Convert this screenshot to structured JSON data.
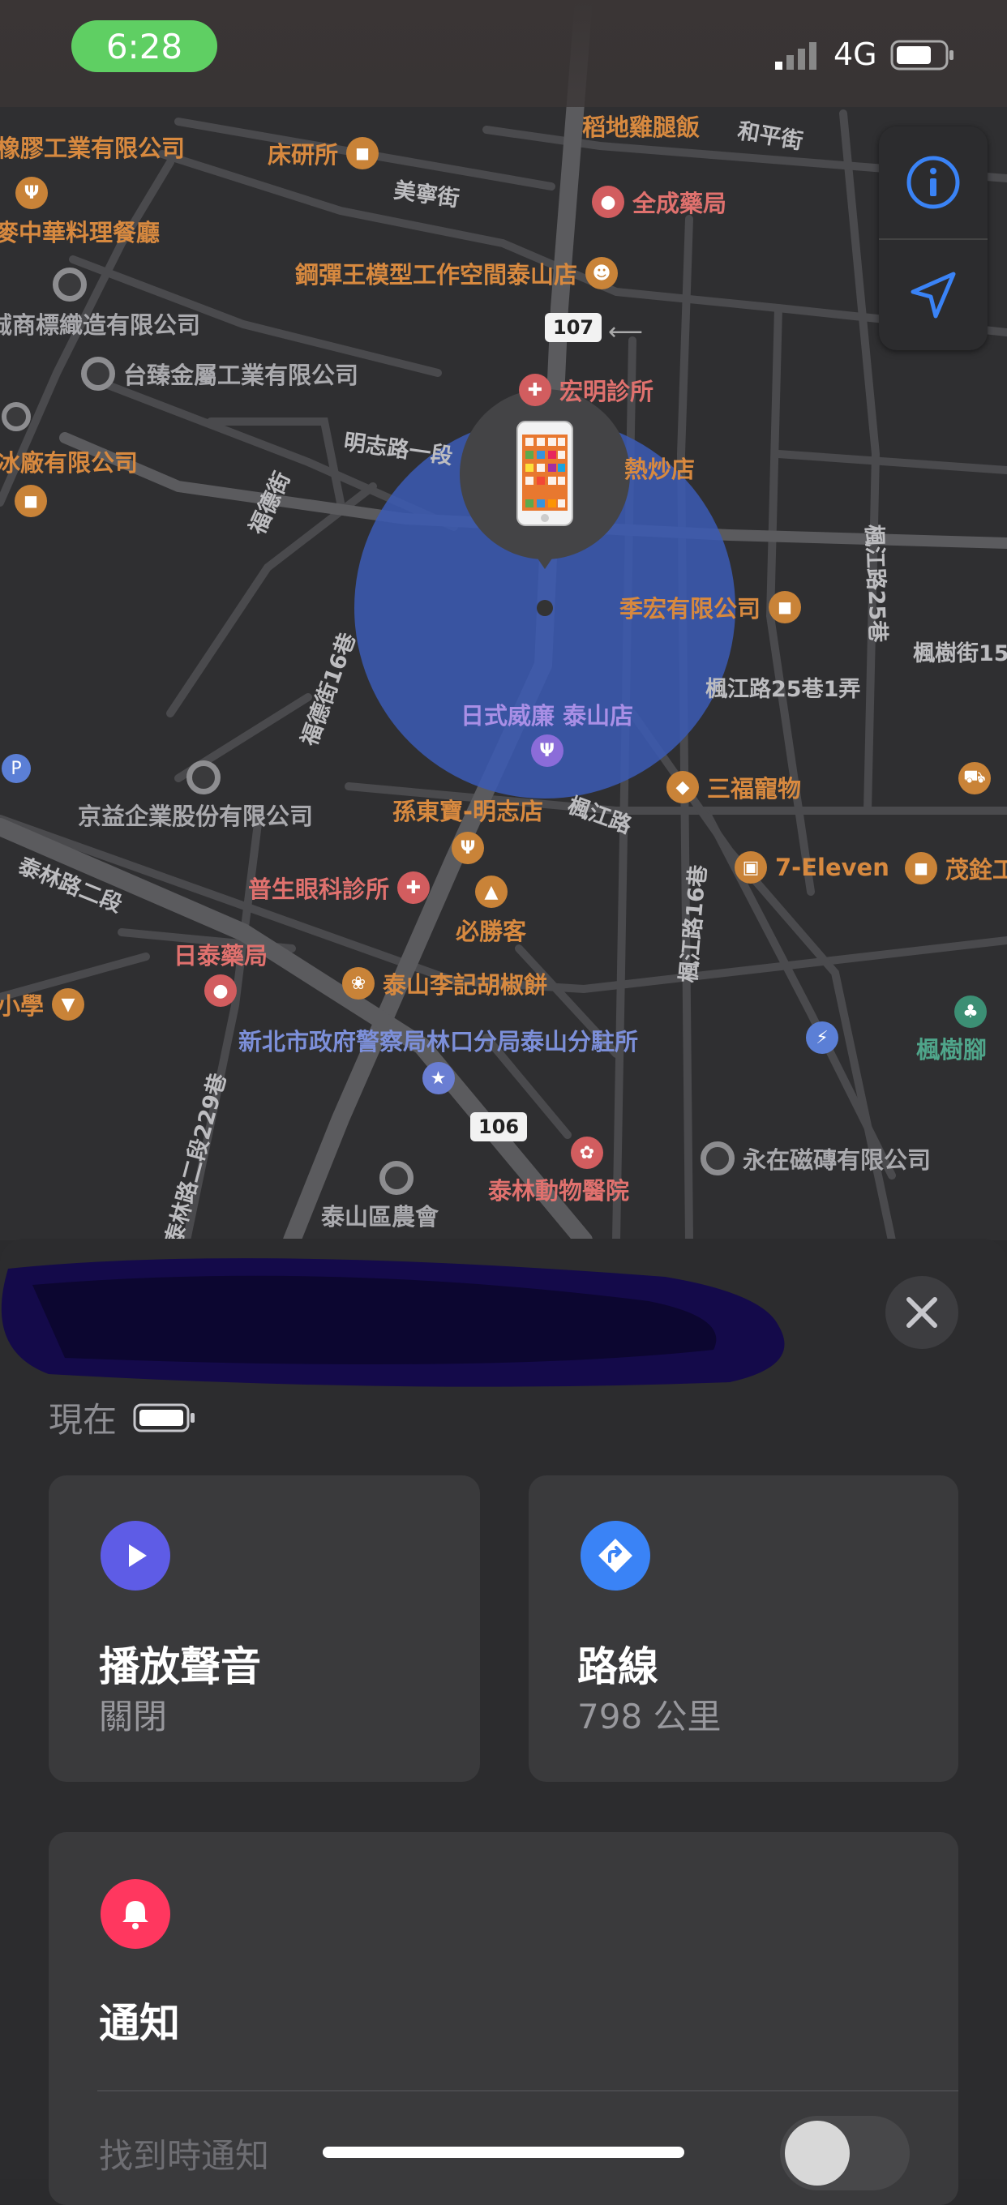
{
  "status": {
    "time": "6:28",
    "network": "4G"
  },
  "map": {
    "pois": [
      {
        "name": "稻地雞腿飯",
        "cls": "orange",
        "icon": "",
        "label_only": true
      },
      {
        "name": "床研所",
        "cls": "orange",
        "icon": "bag"
      },
      {
        "name": "全成藥局",
        "cls": "red",
        "icon": "pill"
      },
      {
        "name": "鋼彈王模型工作空間泰山店",
        "cls": "orange",
        "icon": "robot"
      },
      {
        "name": "宏明診所",
        "cls": "red",
        "icon": "steth"
      },
      {
        "name": "熱炒店",
        "cls": "orange",
        "icon": ""
      },
      {
        "name": "季宏有限公司",
        "cls": "orange",
        "icon": "bag"
      },
      {
        "name": "日式威廉 泰山店",
        "cls": "purple",
        "icon": "fork"
      },
      {
        "name": "三福寵物",
        "cls": "orange",
        "icon": "pet"
      },
      {
        "name": "孫東寶-明志店",
        "cls": "orange",
        "icon": "fork"
      },
      {
        "name": "7-Eleven",
        "cls": "orange",
        "icon": "store"
      },
      {
        "name": "茂銓工",
        "cls": "orange",
        "icon": "bag"
      },
      {
        "name": "京益企業股份有限公司",
        "cls": "gray",
        "icon": ""
      },
      {
        "name": "普生眼科診所",
        "cls": "red",
        "icon": "steth"
      },
      {
        "name": "必勝客",
        "cls": "orange",
        "icon": "pizza"
      },
      {
        "name": "日泰藥局",
        "cls": "red",
        "icon": "pill"
      },
      {
        "name": "泰山李記胡椒餅",
        "cls": "orange",
        "icon": "bread"
      },
      {
        "name": "新北市政府警察局林口分局泰山分駐所",
        "cls": "blue",
        "icon": "badge"
      },
      {
        "name": "永在磁磚有限公司",
        "cls": "gray",
        "icon": ""
      },
      {
        "name": "泰林動物醫院",
        "cls": "red",
        "icon": "paw"
      },
      {
        "name": "泰山區農會",
        "cls": "gray",
        "icon": ""
      },
      {
        "name": "楓樹腳",
        "cls": "green",
        "icon": "tree"
      },
      {
        "name": "台臻金屬工業有限公司",
        "cls": "gray",
        "icon": ""
      },
      {
        "name": "誠商標織造有限公司",
        "cls": "gray",
        "icon": ""
      },
      {
        "name": "麥中華料理餐廳",
        "cls": "orange",
        "icon": "fork"
      },
      {
        "name": "橡膠工業有限公司",
        "cls": "orange",
        "icon": ""
      },
      {
        "name": "冰廠有限公司",
        "cls": "orange",
        "icon": "bag"
      },
      {
        "name": "小學",
        "cls": "orange",
        "icon": "cap"
      }
    ],
    "streets": [
      "和平街",
      "美寧街",
      "明志路一段",
      "福德街",
      "福德街16巷",
      "楓江路25巷",
      "楓樹街15",
      "楓江路25巷1弄",
      "楓江路",
      "楓江路16巷",
      "泰林路二段",
      "泰林路二段229巷"
    ],
    "shields": [
      "107",
      "106"
    ]
  },
  "sheet": {
    "updated": "現在",
    "play_sound": {
      "title": "播放聲音",
      "sub": "關閉"
    },
    "directions": {
      "title": "路線",
      "sub": "798 公里"
    },
    "notify": {
      "title": "通知",
      "row": "找到時通知"
    }
  },
  "colors": {
    "accent": "#3a83f6",
    "play": "#5e5ce6",
    "bell": "#ff375f",
    "accuracy": "#3b5bb5"
  }
}
